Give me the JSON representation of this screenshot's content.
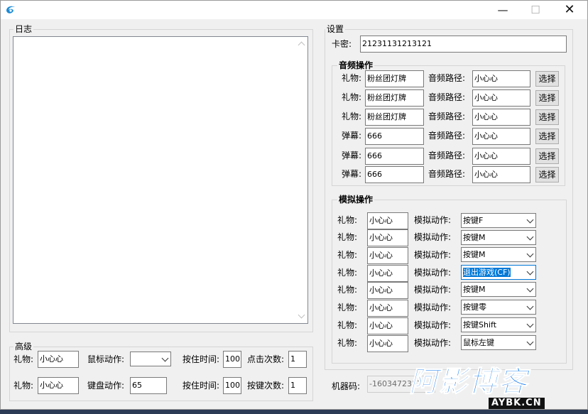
{
  "window": {
    "controls": {
      "minimize": "—",
      "maximize": "☐",
      "close": "✕"
    }
  },
  "log": {
    "label": "日志"
  },
  "settings": {
    "label": "设置",
    "card_label": "卡密:",
    "card_value": "21231131213121"
  },
  "audio": {
    "label": "音频操作",
    "rows": [
      {
        "kind": "礼物:",
        "value": "粉丝团灯牌",
        "path_label": "音频路径:",
        "path": "小心心",
        "button": "选择"
      },
      {
        "kind": "礼物:",
        "value": "粉丝团灯牌",
        "path_label": "音频路径:",
        "path": "小心心",
        "button": "选择"
      },
      {
        "kind": "礼物:",
        "value": "粉丝团灯牌",
        "path_label": "音频路径:",
        "path": "小心心",
        "button": "选择"
      },
      {
        "kind": "弹幕:",
        "value": "666",
        "path_label": "音频路径:",
        "path": "小心心",
        "button": "选择"
      },
      {
        "kind": "弹幕:",
        "value": "666",
        "path_label": "音频路径:",
        "path": "小心心",
        "button": "选择"
      },
      {
        "kind": "弹幕:",
        "value": "666",
        "path_label": "音频路径:",
        "path": "小心心",
        "button": "选择"
      }
    ]
  },
  "simulate": {
    "label": "模拟操作",
    "rows": [
      {
        "kind": "礼物:",
        "value": "小心心",
        "action_label": "模拟动作:",
        "action": "按键F"
      },
      {
        "kind": "礼物:",
        "value": "小心心",
        "action_label": "模拟动作:",
        "action": "按键M"
      },
      {
        "kind": "礼物:",
        "value": "小心心",
        "action_label": "模拟动作:",
        "action": "按键M"
      },
      {
        "kind": "礼物:",
        "value": "小心心",
        "action_label": "模拟动作:",
        "action": "退出游戏(CF)"
      },
      {
        "kind": "礼物:",
        "value": "小心心",
        "action_label": "模拟动作:",
        "action": "按键M"
      },
      {
        "kind": "礼物:",
        "value": "小心心",
        "action_label": "模拟动作:",
        "action": "按键零"
      },
      {
        "kind": "礼物:",
        "value": "小心心",
        "action_label": "模拟动作:",
        "action": "按键Shift"
      },
      {
        "kind": "礼物:",
        "value": "小心心",
        "action_label": "模拟动作:",
        "action": "鼠标左键"
      }
    ]
  },
  "advanced": {
    "label": "高级",
    "row1": {
      "gift_label": "礼物:",
      "gift": "小心心",
      "mouse_label": "鼠标动作:",
      "mouse": "",
      "hold_label": "按住时间:",
      "hold": "100",
      "clicks_label": "点击次数:",
      "clicks": "1"
    },
    "row2": {
      "gift_label": "礼物:",
      "gift": "小心心",
      "kbd_label": "键盘动作:",
      "kbd": "65",
      "hold_label": "按住时间:",
      "hold": "100",
      "keys_label": "按键次数:",
      "keys": "1"
    }
  },
  "machine": {
    "label": "机器码:",
    "value": "-1603472357"
  },
  "watermark": {
    "title": "阿影博客",
    "domain": "AYBK.CN"
  }
}
